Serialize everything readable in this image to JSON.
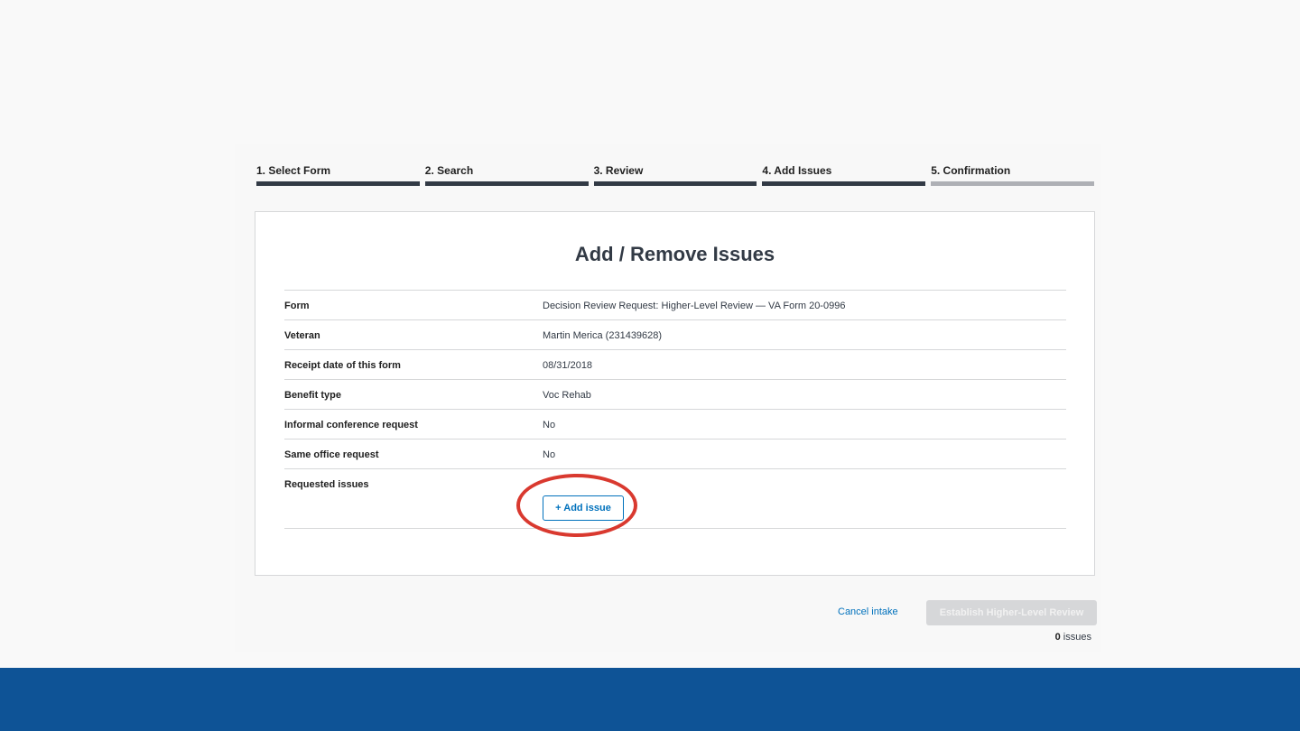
{
  "progress": {
    "steps": [
      {
        "label": "1. Select Form",
        "status": "complete"
      },
      {
        "label": "2. Search",
        "status": "complete"
      },
      {
        "label": "3. Review",
        "status": "complete"
      },
      {
        "label": "4. Add Issues",
        "status": "current"
      },
      {
        "label": "5. Confirmation",
        "status": "todo"
      }
    ]
  },
  "main": {
    "title": "Add / Remove Issues",
    "rows": [
      {
        "label": "Form",
        "value": "Decision Review Request: Higher-Level Review — VA Form 20-0996"
      },
      {
        "label": "Veteran",
        "value": "Martin Merica (231439628)"
      },
      {
        "label": "Receipt date of this form",
        "value": "08/31/2018"
      },
      {
        "label": "Benefit type",
        "value": "Voc Rehab"
      },
      {
        "label": "Informal conference request",
        "value": "No"
      },
      {
        "label": "Same office request",
        "value": "No"
      }
    ],
    "requested_issues_label": "Requested issues",
    "add_issue_label": "+ Add issue"
  },
  "actions": {
    "cancel_label": "Cancel intake",
    "establish_label": "Establish Higher-Level Review",
    "issue_count": "0",
    "issue_count_suffix": " issues"
  },
  "colors": {
    "accent": "#0071bc",
    "highlight": "#d9392f",
    "footer": "#0e5396",
    "progress_complete": "#323a45",
    "progress_todo": "#aeb0b5"
  }
}
